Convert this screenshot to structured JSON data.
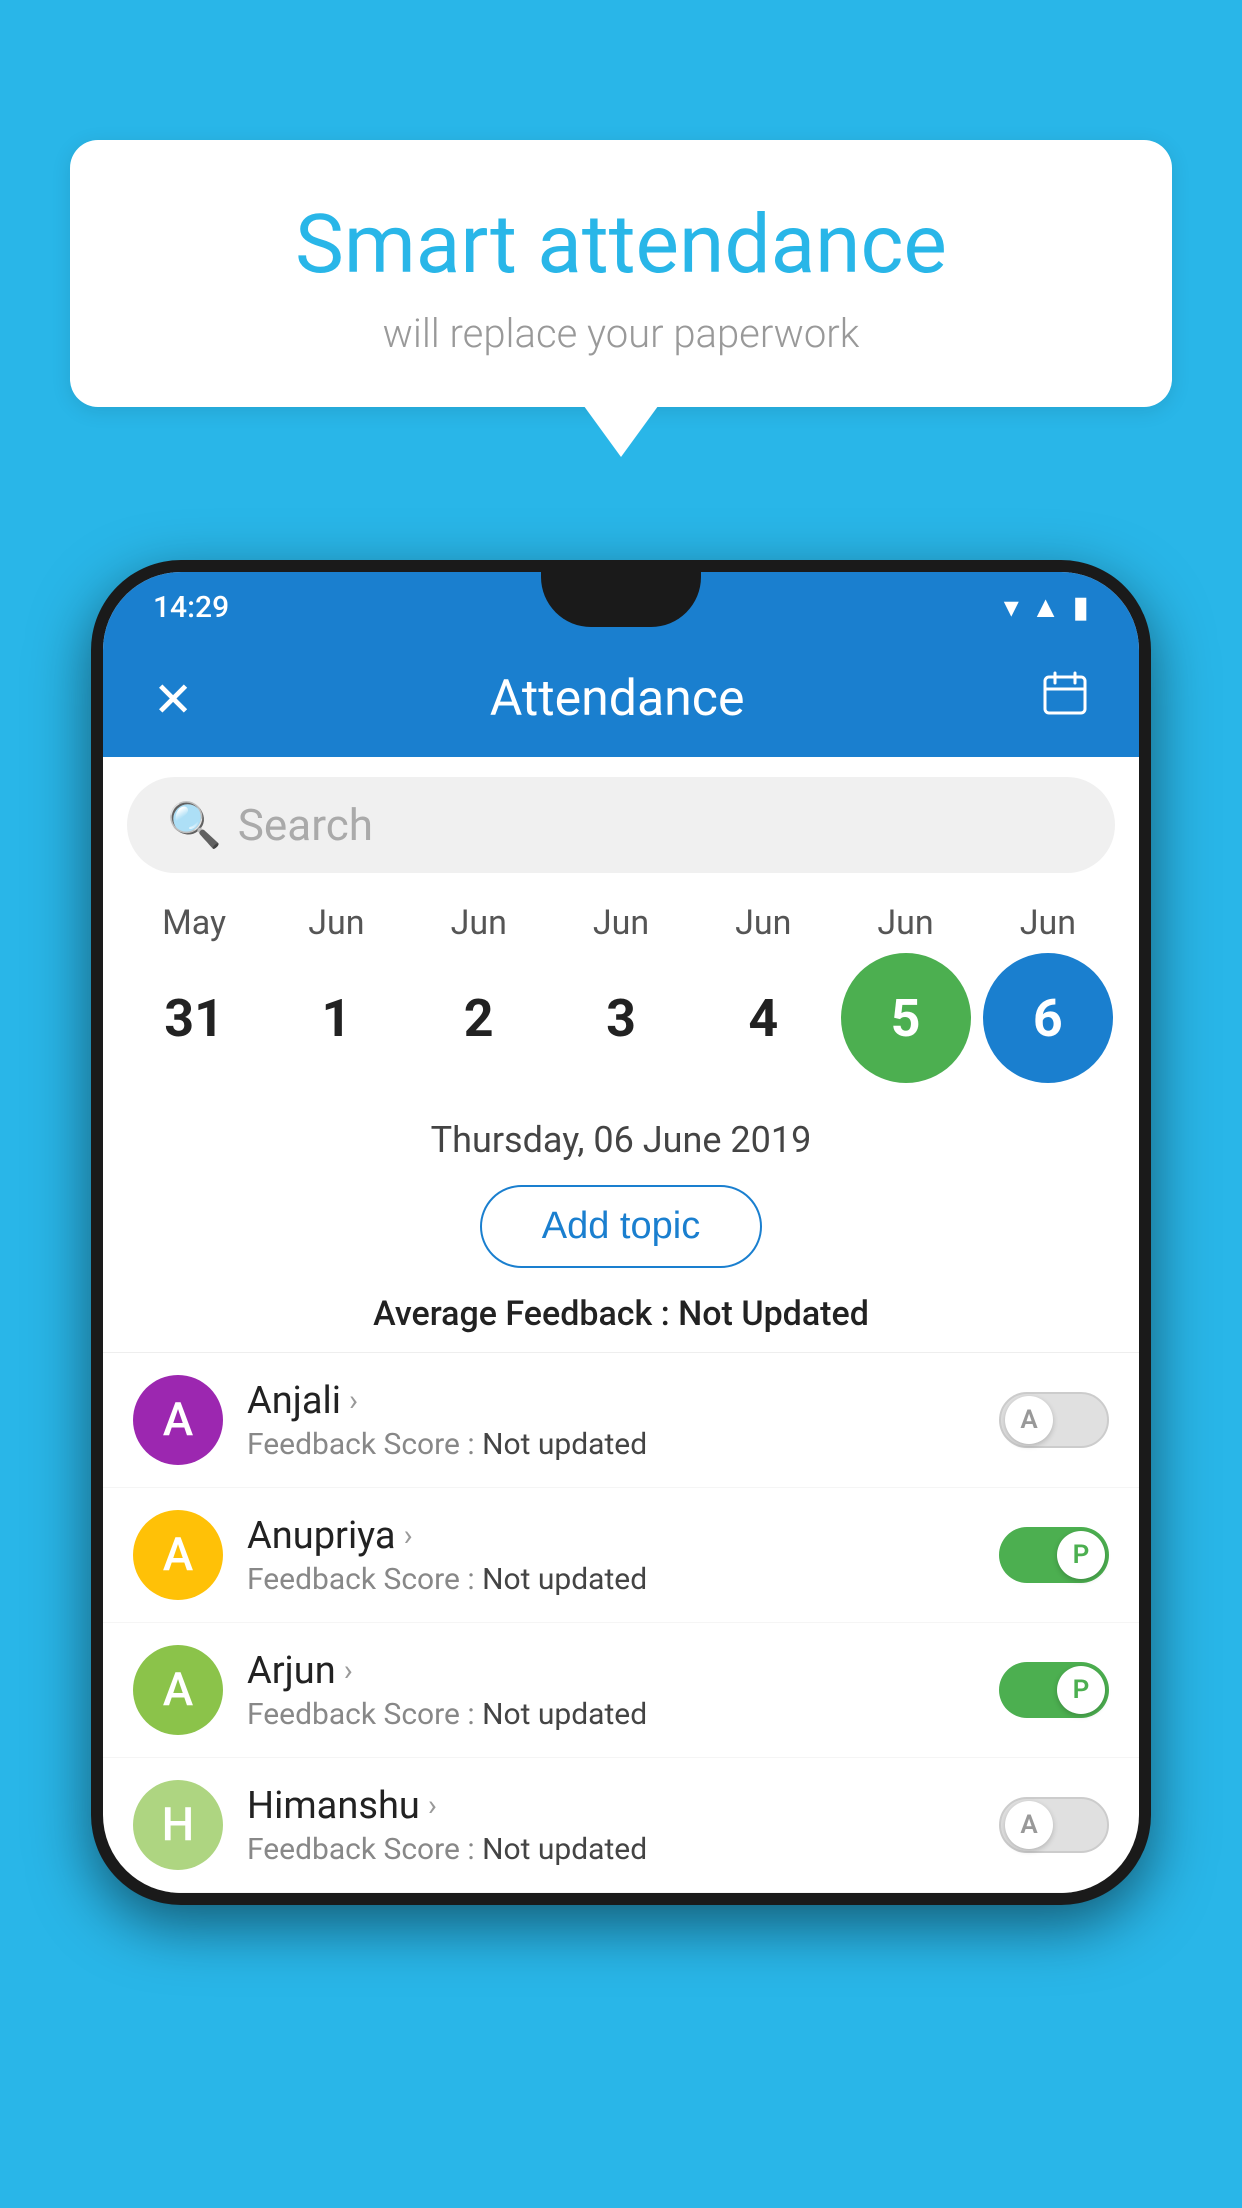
{
  "background_color": "#29b6e8",
  "speech_bubble": {
    "title": "Smart attendance",
    "subtitle": "will replace your paperwork"
  },
  "status_bar": {
    "time": "14:29",
    "icons": [
      "wifi",
      "signal",
      "battery"
    ]
  },
  "app_header": {
    "close_label": "✕",
    "title": "Attendance",
    "calendar_icon": "📅"
  },
  "search": {
    "placeholder": "Search"
  },
  "calendar": {
    "months": [
      "May",
      "Jun",
      "Jun",
      "Jun",
      "Jun",
      "Jun",
      "Jun"
    ],
    "days": [
      "31",
      "1",
      "2",
      "3",
      "4",
      "5",
      "6"
    ],
    "today_index": 5,
    "selected_index": 6
  },
  "date_display": "Thursday, 06 June 2019",
  "add_topic_label": "Add topic",
  "avg_feedback": {
    "label": "Average Feedback : ",
    "value": "Not Updated"
  },
  "students": [
    {
      "name": "Anjali",
      "avatar_letter": "A",
      "avatar_color": "#9c27b0",
      "feedback_label": "Feedback Score : ",
      "feedback_value": "Not updated",
      "toggle_state": "off",
      "toggle_label": "A"
    },
    {
      "name": "Anupriya",
      "avatar_letter": "A",
      "avatar_color": "#ffc107",
      "feedback_label": "Feedback Score : ",
      "feedback_value": "Not updated",
      "toggle_state": "on",
      "toggle_label": "P"
    },
    {
      "name": "Arjun",
      "avatar_letter": "A",
      "avatar_color": "#8bc34a",
      "feedback_label": "Feedback Score : ",
      "feedback_value": "Not updated",
      "toggle_state": "on",
      "toggle_label": "P"
    },
    {
      "name": "Himanshu",
      "avatar_letter": "H",
      "avatar_color": "#aed581",
      "feedback_label": "Feedback Score : ",
      "feedback_value": "Not updated",
      "toggle_state": "off",
      "toggle_label": "A"
    }
  ]
}
